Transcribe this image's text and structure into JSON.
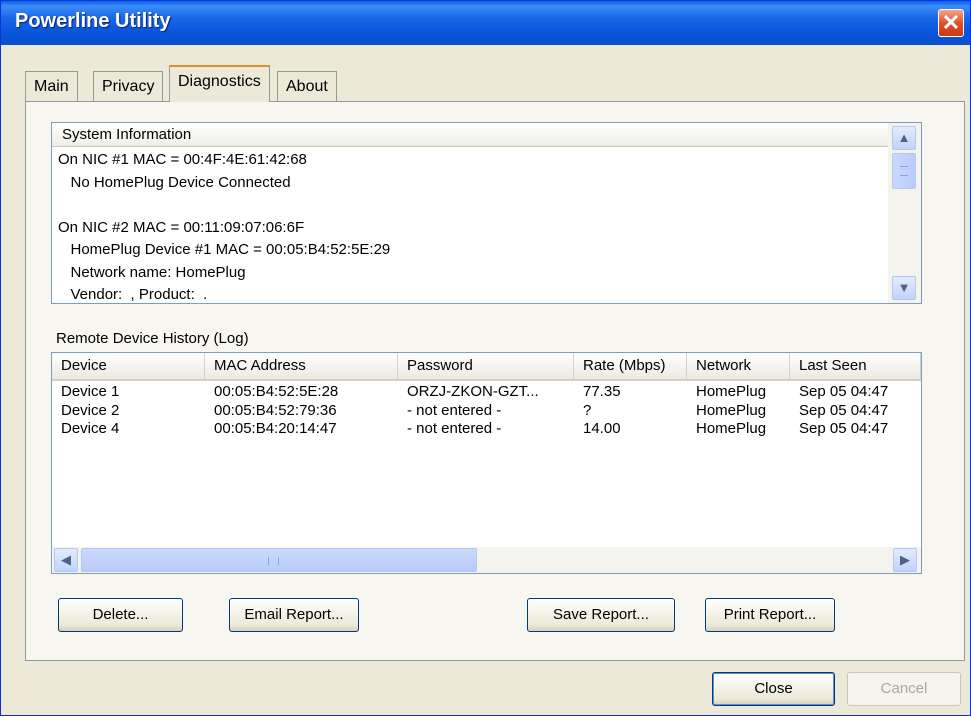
{
  "window": {
    "title": "Powerline Utility",
    "close_glyph": "✕"
  },
  "tabs": [
    {
      "label": "Main"
    },
    {
      "label": "Privacy"
    },
    {
      "label": "Diagnostics"
    },
    {
      "label": "About"
    }
  ],
  "system_info": {
    "header": "System Information",
    "lines": [
      "On NIC #1 MAC = 00:4F:4E:61:42:68",
      "   No HomePlug Device Connected",
      "",
      "On NIC #2 MAC = 00:11:09:07:06:6F",
      "   HomePlug Device #1 MAC = 00:05:B4:52:5E:29",
      "   Network name: HomePlug",
      "   Vendor:  , Product:  ."
    ]
  },
  "log": {
    "label": "Remote Device History (Log)",
    "columns": [
      "Device",
      "MAC Address",
      "Password",
      "Rate (Mbps)",
      "Network",
      "Last Seen"
    ],
    "rows": [
      [
        "Device 1",
        "00:05:B4:52:5E:28",
        "ORZJ-ZKON-GZT...",
        "77.35",
        "HomePlug",
        "Sep 05 04:47"
      ],
      [
        "Device 2",
        "00:05:B4:52:79:36",
        "- not entered -",
        "?",
        "HomePlug",
        "Sep 05 04:47"
      ],
      [
        "Device 4",
        "00:05:B4:20:14:47",
        "- not entered -",
        "14.00",
        "HomePlug",
        "Sep 05 04:47"
      ]
    ]
  },
  "actions": {
    "delete": "Delete...",
    "email": "Email Report...",
    "save": "Save Report...",
    "print": "Print Report..."
  },
  "footer": {
    "close": "Close",
    "cancel": "Cancel"
  },
  "icons": {
    "scroll_up": "▲",
    "scroll_down": "▼",
    "scroll_left": "◀",
    "scroll_right": "▶"
  },
  "colors": {
    "title_bar": "#0a5fe8",
    "dialog_bg": "#ece9d8",
    "active_tab_accent": "#e68b2c"
  }
}
